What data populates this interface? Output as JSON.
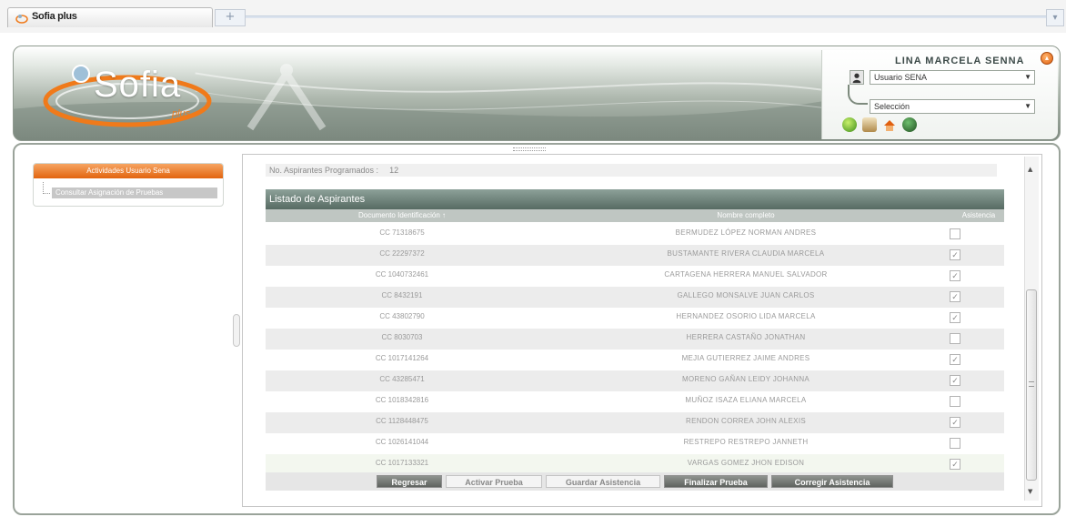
{
  "browser": {
    "tab_title": "Sofia plus",
    "new_tab_symbol": "+",
    "menu_symbol": "▾"
  },
  "header": {
    "logo_text": "Sofia",
    "logo_sub": "plus",
    "user_name": "LINA MARCELA SENNA",
    "role_select": "Usuario SENA",
    "selection_select": "Selección",
    "collapse_symbol": "▴"
  },
  "sidebar": {
    "title": "Actividades Usuario Sena",
    "items": [
      "Consultar Asignación de Pruebas"
    ]
  },
  "main": {
    "programmed_label": "No. Aspirantes Programados :",
    "programmed_value": "12",
    "list_title": "Listado de Aspirantes",
    "columns": [
      "Documento Identificación ↑",
      "Nombre completo",
      "Asistencia"
    ],
    "rows": [
      {
        "doc": "CC 71318675",
        "name": "BERMUDEZ LÓPEZ NORMAN ANDRES",
        "checked": false
      },
      {
        "doc": "CC 22297372",
        "name": "BUSTAMANTE RIVERA CLAUDIA MARCELA",
        "checked": true
      },
      {
        "doc": "CC 1040732461",
        "name": "CARTAGENA HERRERA MANUEL SALVADOR",
        "checked": true
      },
      {
        "doc": "CC 8432191",
        "name": "GALLEGO MONSALVE JUAN CARLOS",
        "checked": true
      },
      {
        "doc": "CC 43802790",
        "name": "HERNANDEZ OSORIO LIDA MARCELA",
        "checked": true
      },
      {
        "doc": "CC 8030703",
        "name": "HERRERA CASTAÑO JONATHAN",
        "checked": false
      },
      {
        "doc": "CC 1017141264",
        "name": "MEJIA GUTIERREZ JAIME ANDRES",
        "checked": true
      },
      {
        "doc": "CC 43285471",
        "name": "MORENO GAÑAN LEIDY JOHANNA",
        "checked": true
      },
      {
        "doc": "CC 1018342816",
        "name": "MUÑOZ ISAZA ELIANA MARCELA",
        "checked": false
      },
      {
        "doc": "CC 1128448475",
        "name": "RENDON CORREA JOHN ALEXIS",
        "checked": true
      },
      {
        "doc": "CC 1026141044",
        "name": "RESTREPO RESTREPO JANNETH",
        "checked": false
      },
      {
        "doc": "CC 1017133321",
        "name": "VARGAS GOMEZ JHON EDISON",
        "checked": true
      }
    ],
    "check_mark": "✓",
    "buttons": [
      "Regresar",
      "Activar Prueba",
      "Guardar Asistencia",
      "Finalizar Prueba",
      "Corregir Asistencia"
    ]
  },
  "colors": {
    "accent_orange": "#e2640f",
    "header_green": "#576b63"
  }
}
